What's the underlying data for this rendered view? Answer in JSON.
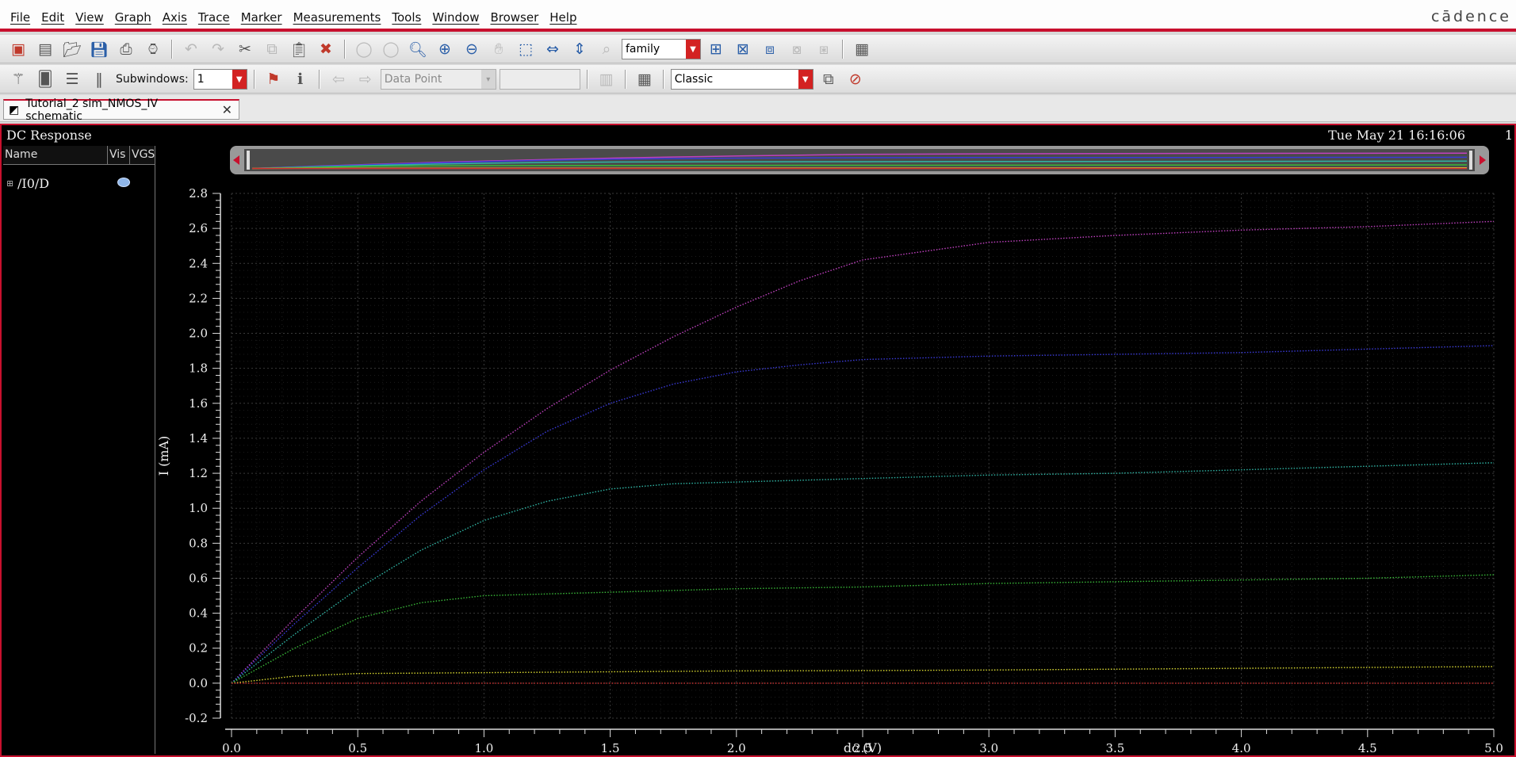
{
  "menubar": {
    "items": [
      "File",
      "Edit",
      "View",
      "Graph",
      "Axis",
      "Trace",
      "Marker",
      "Measurements",
      "Tools",
      "Window",
      "Browser",
      "Help"
    ],
    "brand": "cādence"
  },
  "toolbar1": {
    "family_select": "family"
  },
  "toolbar2": {
    "subwindows_label": "Subwindows:",
    "subwindows_value": "1",
    "data_point_select": "Data Point",
    "style_select": "Classic"
  },
  "tab": {
    "label": "Tutorial_2 sim_NMOS_IV schematic"
  },
  "window": {
    "title": "DC Response",
    "datetime": "Tue May 21 16:16:06",
    "subwindow_number": "1"
  },
  "browser": {
    "columns": [
      "Name",
      "Vis",
      "VGS"
    ],
    "signals": [
      {
        "name": "/I0/D",
        "visible": true
      }
    ]
  },
  "chart_data": {
    "type": "line",
    "xlabel": "dc (V)",
    "ylabel": "I (mA)",
    "xlim": [
      0.0,
      5.0
    ],
    "ylim": [
      -0.2,
      2.8
    ],
    "xticks": [
      "0.0",
      "0.5",
      "1.0",
      "1.5",
      "2.0",
      "2.5",
      "3.0",
      "3.5",
      "4.0",
      "4.5",
      "5.0"
    ],
    "yticks": [
      "-0.2",
      "0.0",
      "0.2",
      "0.4",
      "0.6",
      "0.8",
      "1.0",
      "1.2",
      "1.4",
      "1.6",
      "1.8",
      "2.0",
      "2.2",
      "2.4",
      "2.6",
      "2.8"
    ],
    "grid": true,
    "series": [
      {
        "color": "#c040c0",
        "x": [
          0,
          0.25,
          0.5,
          0.75,
          1.0,
          1.25,
          1.5,
          1.75,
          2.0,
          2.25,
          2.5,
          3.0,
          3.5,
          4.0,
          4.5,
          5.0
        ],
        "y": [
          0,
          0.37,
          0.72,
          1.04,
          1.32,
          1.57,
          1.79,
          1.98,
          2.15,
          2.3,
          2.42,
          2.52,
          2.56,
          2.59,
          2.61,
          2.64
        ]
      },
      {
        "color": "#3a3ad8",
        "x": [
          0,
          0.25,
          0.5,
          0.75,
          1.0,
          1.25,
          1.5,
          1.75,
          2.0,
          2.25,
          2.5,
          3.0,
          3.5,
          4.0,
          4.5,
          5.0
        ],
        "y": [
          0,
          0.34,
          0.66,
          0.96,
          1.22,
          1.44,
          1.6,
          1.71,
          1.78,
          1.82,
          1.85,
          1.87,
          1.88,
          1.89,
          1.91,
          1.93
        ]
      },
      {
        "color": "#2fb5a5",
        "x": [
          0,
          0.25,
          0.5,
          0.75,
          1.0,
          1.25,
          1.5,
          1.75,
          2.0,
          2.5,
          3.0,
          3.5,
          4.0,
          4.5,
          5.0
        ],
        "y": [
          0,
          0.28,
          0.54,
          0.76,
          0.93,
          1.04,
          1.11,
          1.14,
          1.15,
          1.17,
          1.19,
          1.2,
          1.22,
          1.24,
          1.26
        ]
      },
      {
        "color": "#38b838",
        "x": [
          0,
          0.25,
          0.5,
          0.75,
          1.0,
          1.25,
          1.5,
          2.0,
          2.5,
          3.0,
          3.5,
          4.0,
          4.5,
          5.0
        ],
        "y": [
          0,
          0.2,
          0.37,
          0.46,
          0.5,
          0.51,
          0.52,
          0.54,
          0.55,
          0.57,
          0.58,
          0.59,
          0.6,
          0.62
        ]
      },
      {
        "color": "#d8d830",
        "x": [
          0,
          0.25,
          0.5,
          1.0,
          1.5,
          2.0,
          2.5,
          3.0,
          3.5,
          4.0,
          4.5,
          5.0
        ],
        "y": [
          0,
          0.04,
          0.055,
          0.06,
          0.065,
          0.07,
          0.072,
          0.075,
          0.08,
          0.085,
          0.09,
          0.095
        ]
      },
      {
        "color": "#d03030",
        "x": [
          0,
          5.0
        ],
        "y": [
          0,
          0
        ]
      }
    ]
  }
}
